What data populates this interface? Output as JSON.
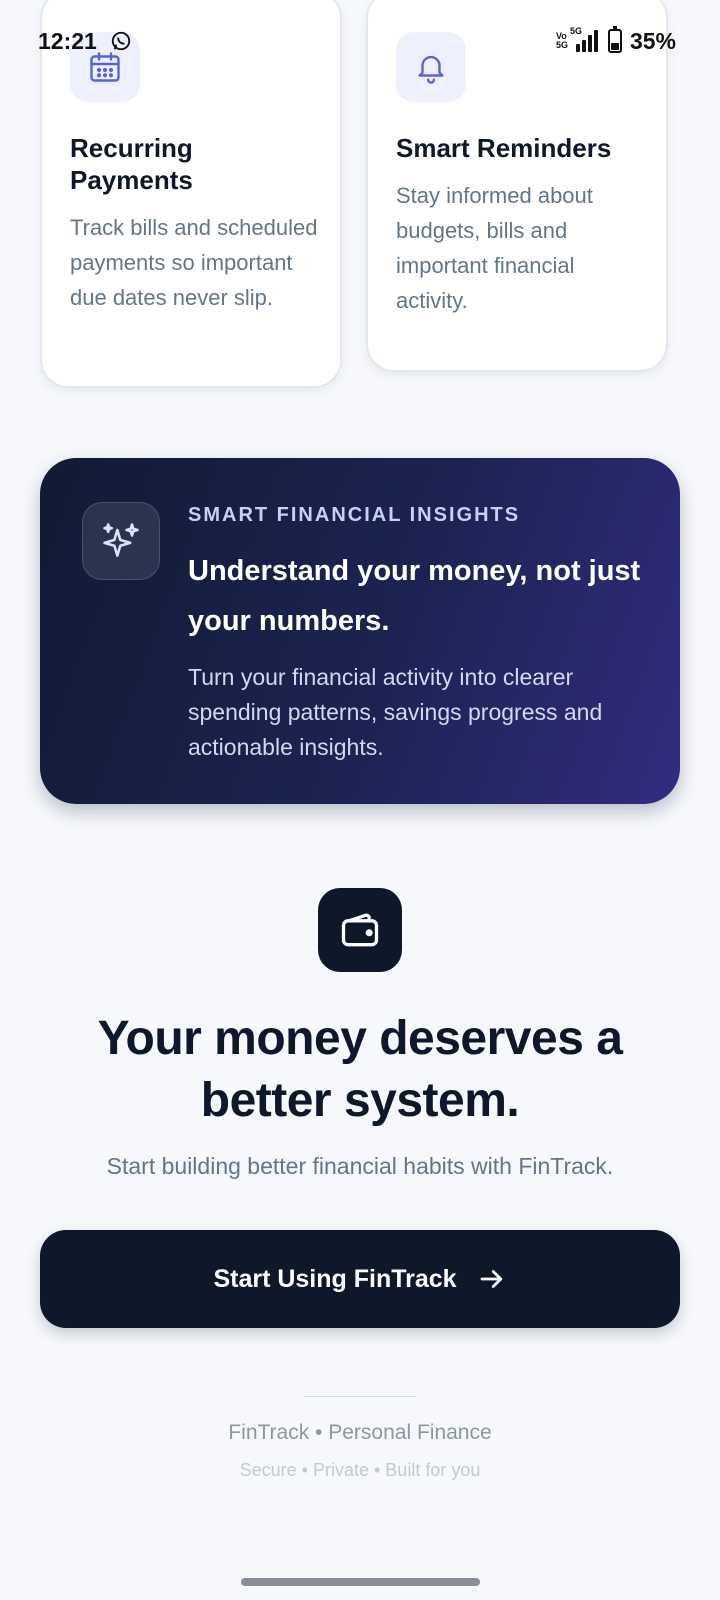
{
  "status_bar": {
    "time": "12:21",
    "network_label": "Vo 5G",
    "signal_label": "5G",
    "battery": "35%",
    "battery_level": 0.35
  },
  "feature_cards": [
    {
      "icon": "calendar-icon",
      "title": "Recurring Payments",
      "description": "Track bills and scheduled payments so important due dates never slip."
    },
    {
      "icon": "bell-icon",
      "title": "Smart Reminders",
      "description": "Stay informed about budgets, bills and important financial activity."
    }
  ],
  "insights": {
    "icon": "sparkles-icon",
    "eyebrow": "SMART FINANCIAL INSIGHTS",
    "title": "Understand your money, not just your numbers.",
    "description": "Turn your financial activity into clearer spending patterns, savings progress and actionable insights."
  },
  "cta": {
    "icon": "wallet-icon",
    "title": "Your money deserves a better system.",
    "subtitle": "Start building better financial habits with FinTrack.",
    "button_label": "Start Using FinTrack",
    "button_icon": "arrow-right-icon"
  },
  "footer": {
    "brand": "FinTrack • Personal Finance",
    "tagline": "Secure • Private • Built for you"
  },
  "colors": {
    "background": "#f6f8fb",
    "primary_dark": "#0f172a",
    "accent_indigo": "#5b63d6",
    "muted_text": "#64748b"
  }
}
